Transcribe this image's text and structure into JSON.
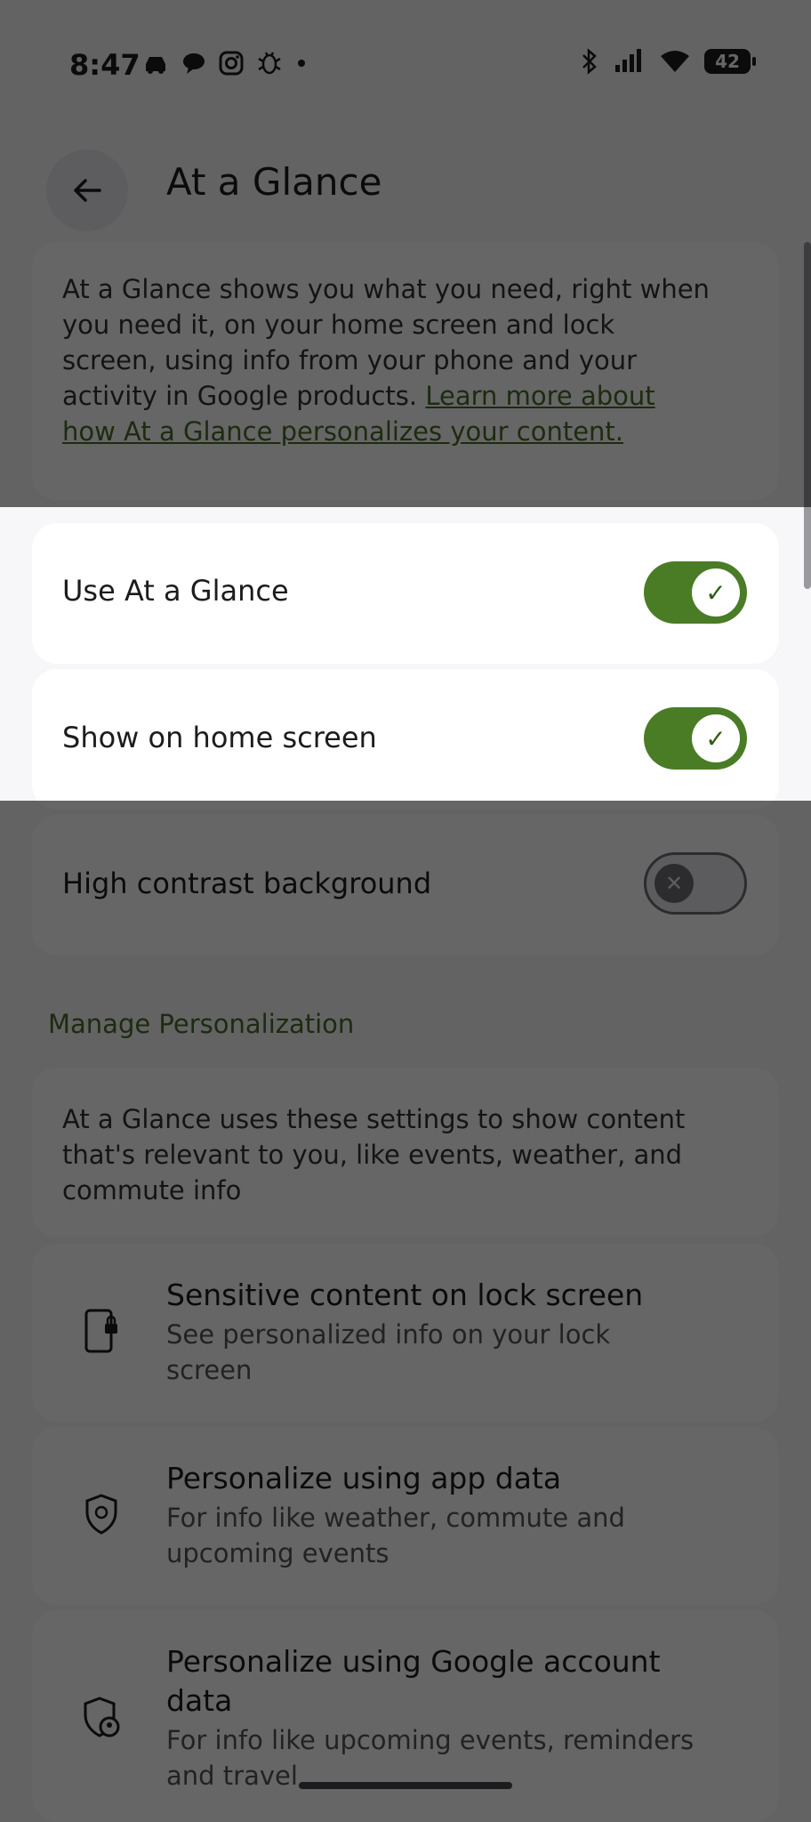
{
  "status_bar": {
    "time": "8:47",
    "battery": "42",
    "left_icons": [
      "car-icon",
      "chat-icon",
      "instagram-icon",
      "bug-icon",
      "dot-icon"
    ],
    "right_icons": [
      "bluetooth-icon",
      "signal-icon",
      "wifi-icon"
    ]
  },
  "header": {
    "title": "At a Glance",
    "back_icon": "arrow-back-icon"
  },
  "intro": {
    "text": "At a Glance shows you what you need, right when you need it, on your home screen and lock screen, using info from your phone and your activity in Google products. ",
    "link": "Learn more about how At a Glance personalizes your content."
  },
  "toggles": [
    {
      "label": "Use At a Glance",
      "state": "on"
    },
    {
      "label": "Show on home screen",
      "state": "on"
    },
    {
      "label": "High contrast background",
      "state": "off"
    }
  ],
  "personalization": {
    "section_title": "Manage Personalization",
    "description": "At a Glance uses these settings to show content that's relevant to you, like events, weather, and commute info",
    "items": [
      {
        "title": "Sensitive content on lock screen",
        "subtitle": "See personalized info on your lock screen",
        "icon": "lock-phone-icon"
      },
      {
        "title": "Personalize using app data",
        "subtitle": "For info like weather, commute and upcoming events",
        "icon": "shield-icon"
      },
      {
        "title": "Personalize using Google account data",
        "subtitle": "For info like upcoming events, reminders and travel",
        "icon": "account-shield-icon"
      }
    ]
  },
  "colors": {
    "accent": "#4a7c26",
    "link": "#4a6b2a",
    "background": "#f7f7fa"
  }
}
